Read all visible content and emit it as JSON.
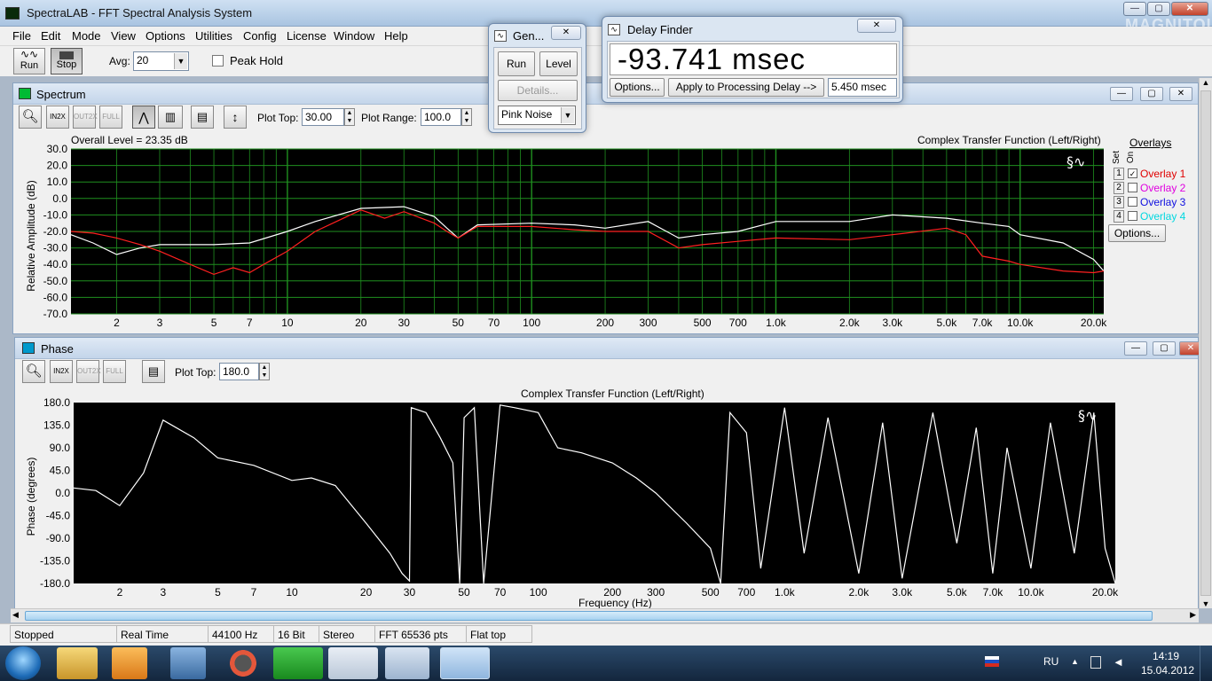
{
  "app": {
    "title": "SpectraLAB - FFT Spectral Analysis System"
  },
  "menu": [
    "File",
    "Edit",
    "Mode",
    "View",
    "Options",
    "Utilities",
    "Config",
    "License",
    "Window",
    "Help"
  ],
  "toolbar": {
    "run_label": "Run",
    "stop_label": "Stop",
    "avg_label": "Avg:",
    "avg_value": "20",
    "peak_hold_label": "Peak Hold"
  },
  "spectrum": {
    "title": "Spectrum",
    "plot_top_label": "Plot Top:",
    "plot_top_value": "30.00",
    "plot_range_label": "Plot Range:",
    "plot_range_value": "100.0",
    "overall_level": "Overall Level = 23.35 dB",
    "chart_title": "Complex Transfer Function (Left/Right)",
    "ylabel": "Relative Amplitude (dB)",
    "y_ticks": [
      "30.0",
      "20.0",
      "10.0",
      "0.0",
      "-10.0",
      "-20.0",
      "-30.0",
      "-40.0",
      "-50.0",
      "-60.0",
      "-70.0"
    ],
    "x_ticks": [
      "2",
      "3",
      "5",
      "7",
      "10",
      "20",
      "30",
      "50",
      "70",
      "100",
      "200",
      "300",
      "500",
      "700",
      "1.0k",
      "2.0k",
      "3.0k",
      "5.0k",
      "7.0k",
      "10.0k",
      "20.0k"
    ],
    "overlays_label": "Overlays",
    "set_label": "Set",
    "on_label": "On",
    "overlays": [
      {
        "num": "1",
        "label": "Overlay 1",
        "checked": true,
        "color": "#e00000"
      },
      {
        "num": "2",
        "label": "Overlay 2",
        "checked": false,
        "color": "#e000e0"
      },
      {
        "num": "3",
        "label": "Overlay 3",
        "checked": false,
        "color": "#1010e0"
      },
      {
        "num": "4",
        "label": "Overlay 4",
        "checked": false,
        "color": "#00d8e0"
      }
    ],
    "options_label": "Options..."
  },
  "phase": {
    "title": "Phase",
    "plot_top_label": "Plot Top:",
    "plot_top_value": "180.0",
    "chart_title": "Complex Transfer Function (Left/Right)",
    "ylabel": "Phase (degrees)",
    "xlabel": "Frequency (Hz)",
    "y_ticks": [
      "180.0",
      "135.0",
      "90.0",
      "45.0",
      "0.0",
      "-45.0",
      "-90.0",
      "-135.0",
      "-180.0"
    ],
    "x_ticks": [
      "2",
      "3",
      "5",
      "7",
      "10",
      "20",
      "30",
      "50",
      "70",
      "100",
      "200",
      "300",
      "500",
      "700",
      "1.0k",
      "2.0k",
      "3.0k",
      "5.0k",
      "7.0k",
      "10.0k",
      "20.0k"
    ]
  },
  "chart_data": [
    {
      "type": "line",
      "title": "Complex Transfer Function (Left/Right)",
      "ylabel": "Relative Amplitude (dB)",
      "xscale": "log",
      "xlim": [
        1.3,
        22000
      ],
      "ylim": [
        -70,
        30
      ],
      "grid": true,
      "series": [
        {
          "name": "",
          "color": "#ffffff",
          "x": [
            1.3,
            1.6,
            2,
            2.5,
            3,
            4,
            5,
            7,
            10,
            13,
            20,
            30,
            40,
            45,
            50,
            60,
            100,
            150,
            200,
            300,
            400,
            500,
            700,
            1000,
            2000,
            3000,
            5000,
            7000,
            9000,
            10000,
            15000,
            20000,
            22000
          ],
          "y": [
            -22,
            -27,
            -34,
            -30,
            -28,
            -28,
            -28,
            -27,
            -20,
            -14,
            -6,
            -5,
            -11,
            -18,
            -24,
            -16,
            -15,
            -16,
            -18,
            -14,
            -24,
            -22,
            -20,
            -14,
            -14,
            -10,
            -12,
            -15,
            -17,
            -22,
            -27,
            -37,
            -44
          ]
        },
        {
          "name": "Overlay 1",
          "color": "#ff2020",
          "x": [
            1.3,
            1.6,
            2,
            2.5,
            3,
            4,
            5,
            6,
            7,
            8,
            10,
            13,
            20,
            25,
            30,
            40,
            45,
            50,
            60,
            100,
            150,
            200,
            300,
            400,
            500,
            700,
            1000,
            2000,
            3000,
            5000,
            6000,
            7000,
            9000,
            10000,
            15000,
            20000,
            22000
          ],
          "y": [
            -20,
            -21,
            -24,
            -28,
            -32,
            -40,
            -46,
            -42,
            -45,
            -40,
            -32,
            -20,
            -7,
            -12,
            -8,
            -15,
            -20,
            -24,
            -17,
            -17,
            -19,
            -20,
            -20,
            -30,
            -28,
            -26,
            -24,
            -25,
            -22,
            -18,
            -22,
            -35,
            -38,
            -40,
            -44,
            -45,
            -44
          ]
        }
      ]
    },
    {
      "type": "line",
      "title": "Complex Transfer Function (Left/Right)",
      "ylabel": "Phase (degrees)",
      "xlabel": "Frequency (Hz)",
      "xscale": "log",
      "xlim": [
        1.3,
        22000
      ],
      "ylim": [
        -180,
        180
      ],
      "grid": false,
      "series": [
        {
          "name": "",
          "color": "#ffffff",
          "x": [
            1.3,
            1.6,
            2,
            2.5,
            3,
            4,
            5,
            7,
            10,
            12,
            15,
            20,
            25,
            28,
            30,
            30.5,
            35,
            40,
            45,
            48,
            50,
            55,
            60,
            70,
            80,
            100,
            120,
            150,
            200,
            250,
            300,
            400,
            500,
            550,
            600,
            700,
            800,
            1000,
            1200,
            1500,
            2000,
            2500,
            3000,
            4000,
            5000,
            6000,
            7000,
            8000,
            10000,
            12000,
            15000,
            18000,
            20000,
            22000
          ],
          "y": [
            10,
            5,
            -25,
            40,
            145,
            110,
            70,
            55,
            25,
            30,
            15,
            -60,
            -120,
            -160,
            -175,
            170,
            160,
            110,
            60,
            -180,
            150,
            170,
            -180,
            175,
            170,
            160,
            90,
            80,
            60,
            30,
            0,
            -60,
            -110,
            -180,
            160,
            120,
            -150,
            170,
            -120,
            150,
            -160,
            140,
            -170,
            160,
            -100,
            130,
            -160,
            90,
            -150,
            140,
            -120,
            160,
            -110,
            -180
          ]
        }
      ]
    }
  ],
  "generator": {
    "title": "Gen...",
    "run_label": "Run",
    "level_label": "Level",
    "details_label": "Details...",
    "signal_value": "Pink Noise"
  },
  "delay_finder": {
    "title": "Delay Finder",
    "value_text": "-93.741 msec",
    "options_label": "Options...",
    "apply_label": "Apply to Processing Delay -->",
    "delay_value": "5.450 msec"
  },
  "statusbar": [
    "Stopped",
    "Real Time",
    "44100 Hz",
    "16 Bit",
    "Stereo",
    "FFT 65536 pts",
    "Flat top"
  ],
  "taskbar": {
    "lang": "RU",
    "time": "14:19",
    "date": "15.04.2012"
  },
  "watermark": "MAGNITOLA"
}
